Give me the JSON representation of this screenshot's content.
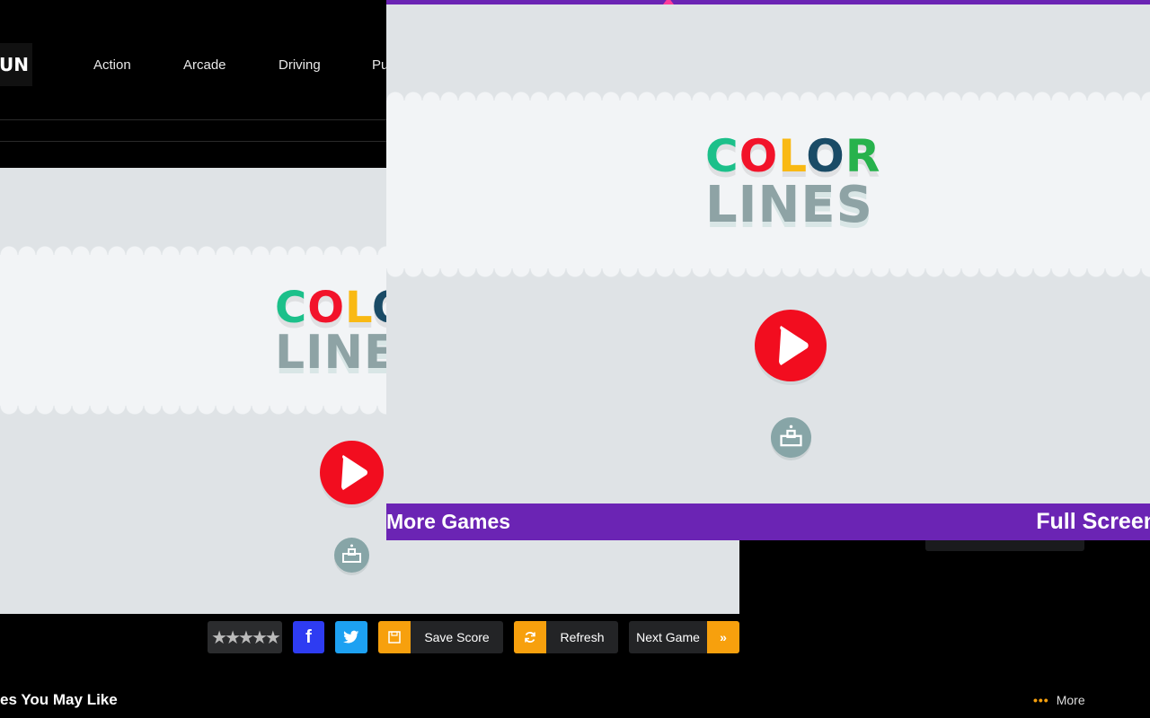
{
  "header": {
    "logo_text": "FUN",
    "nav": [
      "Action",
      "Arcade",
      "Driving",
      "Puzzle"
    ]
  },
  "game": {
    "title_line1": [
      "C",
      "O",
      "L",
      "O",
      "R"
    ],
    "title_line1_colors": [
      "#1cc08a",
      "#f2132a",
      "#f9b914",
      "#1a4b66",
      "#27b24c"
    ],
    "title_line2": "LINES",
    "play_icon": "play-icon",
    "leaderboard_icon": "podium-icon"
  },
  "toolbar": {
    "rating_stars": "★★★★★",
    "facebook_label": "f",
    "save_label": "Save Score",
    "refresh_label": "Refresh",
    "next_label": "Next Game",
    "accent": "#f7a00d"
  },
  "section": {
    "may_like": "es You May Like",
    "more": "More",
    "more_dots": "•••"
  },
  "popup": {
    "more_games": "More Games",
    "full_screen": "Full Screen",
    "bar_color": "#6b24b4"
  }
}
